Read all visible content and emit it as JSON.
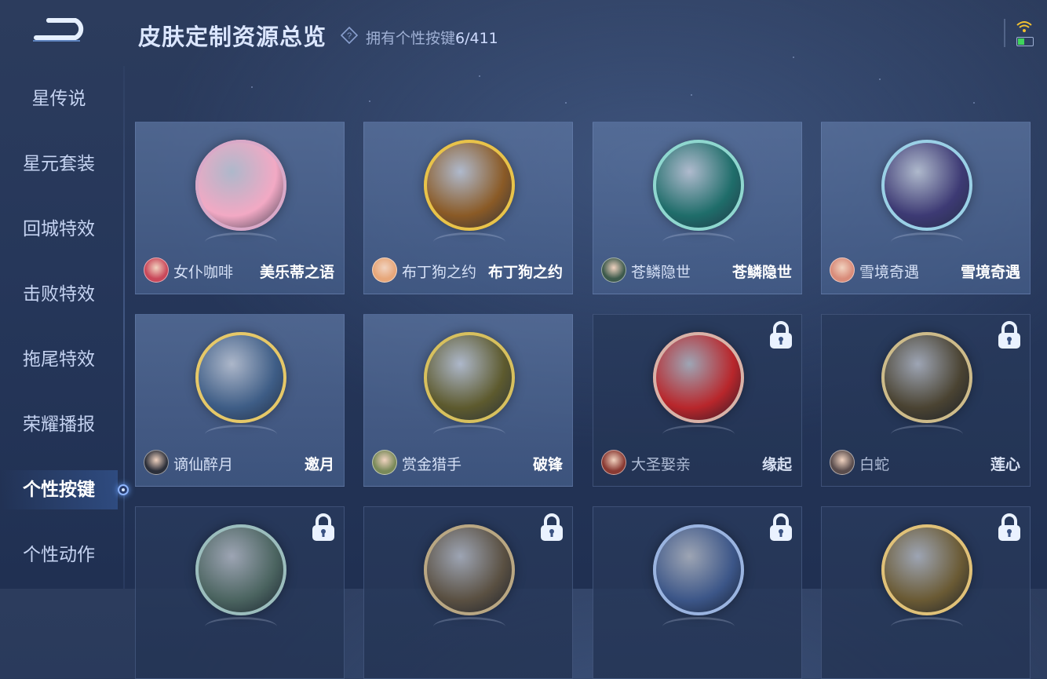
{
  "header": {
    "title": "皮肤定制资源总览",
    "owned_label": "拥有个性按键",
    "owned_count": "6/411"
  },
  "sidebar": {
    "items": [
      {
        "label": "星传说"
      },
      {
        "label": "星元套装"
      },
      {
        "label": "回城特效"
      },
      {
        "label": "击败特效"
      },
      {
        "label": "拖尾特效"
      },
      {
        "label": "荣耀播报"
      },
      {
        "label": "个性按键",
        "active": true
      },
      {
        "label": "个性动作"
      }
    ]
  },
  "cards": [
    {
      "hero": "女仆咖啡",
      "skin": "美乐蒂之语",
      "locked": false,
      "icon": "my-melody-icon",
      "ring": "#d9a9c8",
      "bg": "#f2a9c4",
      "avatar": "#c9485a"
    },
    {
      "hero": "布丁狗之约",
      "skin": "布丁狗之约",
      "locked": false,
      "icon": "golden-bow-icon",
      "ring": "#e8c34a",
      "bg": "#8a5a26",
      "avatar": "#e7a77a"
    },
    {
      "hero": "苍鳞隐世",
      "skin": "苍鳞隐世",
      "locked": false,
      "icon": "jade-blade-icon",
      "ring": "#8fd7cf",
      "bg": "#1f6d6a",
      "avatar": "#3d5a4c"
    },
    {
      "hero": "雪境奇遇",
      "skin": "雪境奇遇",
      "locked": false,
      "icon": "purple-flower-icon",
      "ring": "#9ad0e6",
      "bg": "#3d3a74",
      "avatar": "#d98c7a"
    },
    {
      "hero": "谪仙醉月",
      "skin": "邀月",
      "locked": false,
      "icon": "moon-sword-icon",
      "ring": "#e6c868",
      "bg": "#3e5d86",
      "avatar": "#2b2f3a"
    },
    {
      "hero": "赏金猎手",
      "skin": "破锋",
      "locked": false,
      "icon": "green-blade-icon",
      "ring": "#d7c05e",
      "bg": "#5d5a2e",
      "avatar": "#7a8a5a"
    },
    {
      "hero": "大圣娶亲",
      "skin": "缘起",
      "locked": true,
      "icon": "red-scroll-icon",
      "ring": "#d8b3a8",
      "bg": "#b8262b",
      "avatar": "#8a3a33"
    },
    {
      "hero": "白蛇",
      "skin": "莲心",
      "locked": true,
      "icon": "lotus-icon",
      "ring": "#cdbb8a",
      "bg": "#4a4332",
      "avatar": "#5a4d4d"
    },
    {
      "hero": "",
      "skin": "",
      "locked": true,
      "icon": "clock-rune-icon",
      "ring": "#9bbdbd",
      "bg": "#4b6460",
      "avatar": ""
    },
    {
      "hero": "",
      "skin": "",
      "locked": true,
      "icon": "bronze-staff-icon",
      "ring": "#b9a783",
      "bg": "#5a5042",
      "avatar": ""
    },
    {
      "hero": "",
      "skin": "",
      "locked": true,
      "icon": "blue-wing-icon",
      "ring": "#9ab4e0",
      "bg": "#3c5688",
      "avatar": ""
    },
    {
      "hero": "",
      "skin": "",
      "locked": true,
      "icon": "golden-veil-icon",
      "ring": "#e0c178",
      "bg": "#6a5a34",
      "avatar": ""
    }
  ]
}
